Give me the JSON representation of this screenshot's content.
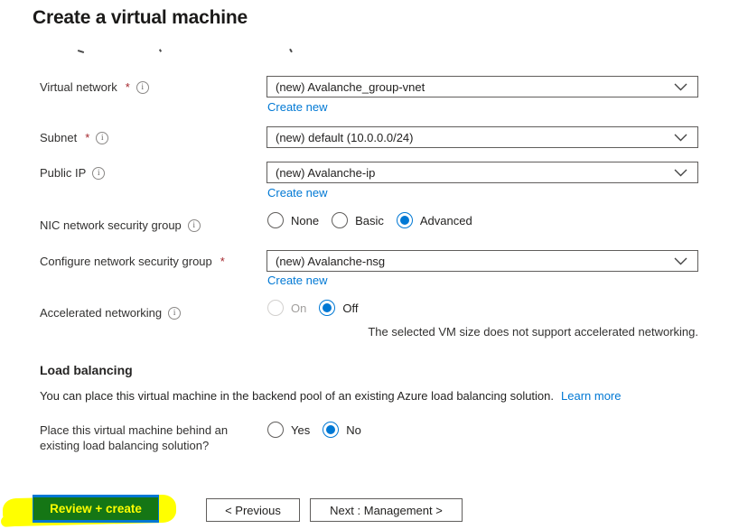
{
  "title": "Create a virtual machine",
  "ui": {
    "required_marker": "*",
    "info_glyph": "i"
  },
  "colors": {
    "accent_blue": "#0078d4",
    "link_blue": "#0078d4",
    "required_red": "#a4262c",
    "highlight_yellow": "#ffff00",
    "annotation_green": "#157615",
    "review_button_blue": "#0078d4"
  },
  "fields": {
    "virtual_network": {
      "label": "Virtual network",
      "value": "(new) Avalanche_group-vnet",
      "create_new": "Create new"
    },
    "subnet": {
      "label": "Subnet",
      "value": "(new) default (10.0.0.0/24)"
    },
    "public_ip": {
      "label": "Public IP",
      "value": "(new) Avalanche-ip",
      "create_new": "Create new"
    },
    "nic_nsg": {
      "label": "NIC network security group",
      "options": {
        "none": "None",
        "basic": "Basic",
        "advanced": "Advanced"
      },
      "selected": "Advanced"
    },
    "configure_nsg": {
      "label": "Configure network security group",
      "value": "(new) Avalanche-nsg",
      "create_new": "Create new"
    },
    "accelerated_networking": {
      "label": "Accelerated networking",
      "options": {
        "on": "On",
        "off": "Off"
      },
      "selected": "Off",
      "disabled_option": "On",
      "note": "The selected VM size does not support accelerated networking."
    }
  },
  "load_balancing": {
    "heading": "Load balancing",
    "description": "You can place this virtual machine in the backend pool of an existing Azure load balancing solution.",
    "learn_more": "Learn more",
    "question": "Place this virtual machine behind an existing load balancing solution?",
    "options": {
      "yes": "Yes",
      "no": "No"
    },
    "selected": "No"
  },
  "footer": {
    "review_create": "Review + create",
    "previous": "< Previous",
    "next": "Next : Management >"
  }
}
